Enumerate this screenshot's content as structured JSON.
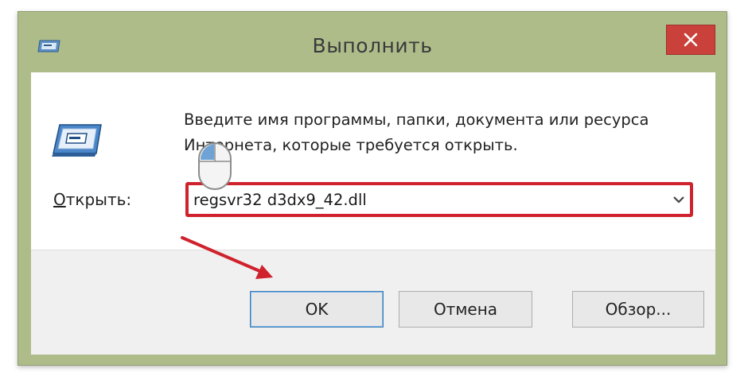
{
  "window": {
    "title": "Выполнить",
    "close_icon": "close-icon"
  },
  "dialog": {
    "description": "Введите имя программы, папки, документа или ресурса Интернета, которые требуется открыть.",
    "open_label_underlined": "О",
    "open_label_rest": "ткрыть:",
    "input_value": "regsvr32 d3dx9_42.dll",
    "run_icon": "run-dialog-icon",
    "chevron_icon": "chevron-down-icon"
  },
  "buttons": {
    "ok": "OK",
    "cancel": "Отмена",
    "browse": "Обзор..."
  },
  "annotations": {
    "highlight_color": "#d0222c",
    "arrow_color": "#d0222c",
    "cursor_icon": "mouse-icon"
  },
  "colors": {
    "frame": "#aebc8a",
    "close_button": "#c9413a",
    "footer": "#f0f0f0",
    "ok_border": "#3c7fb1"
  }
}
